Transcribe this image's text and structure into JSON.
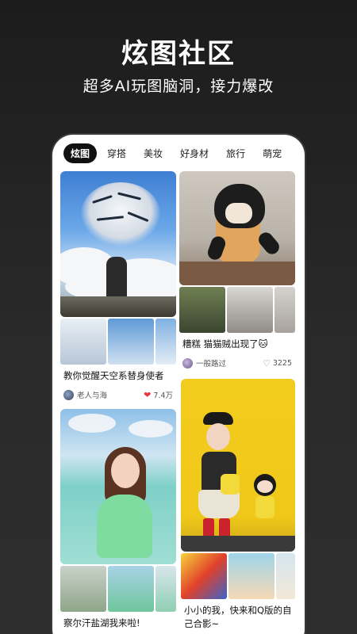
{
  "hero": {
    "title": "炫图社区",
    "subtitle": "超多AI玩图脑洞，接力爆改"
  },
  "tabs": [
    {
      "label": "炫图",
      "active": true
    },
    {
      "label": "穿搭",
      "active": false
    },
    {
      "label": "美妆",
      "active": false
    },
    {
      "label": "好身材",
      "active": false
    },
    {
      "label": "旅行",
      "active": false
    },
    {
      "label": "萌宠",
      "active": false
    }
  ],
  "feed": {
    "left": [
      {
        "caption": "教你觉醒天空系替身使者",
        "author": "老人与海",
        "likes": "7.4万",
        "liked": true
      },
      {
        "caption": "察尔汗盐湖我来啦!",
        "author": "",
        "likes": ""
      }
    ],
    "right": [
      {
        "caption": "糟糕 猫猫贼出现了🐱",
        "author": "一般路过",
        "likes": "3225",
        "liked": false
      },
      {
        "caption": "小小的我，快来和Q版的自己合影~",
        "author": "",
        "likes": ""
      }
    ]
  },
  "icons": {
    "liked": "heart-filled-icon",
    "not_liked": "heart-outline-icon"
  },
  "colors": {
    "liked_heart": "#e8383d",
    "tab_active_bg": "#111111"
  }
}
